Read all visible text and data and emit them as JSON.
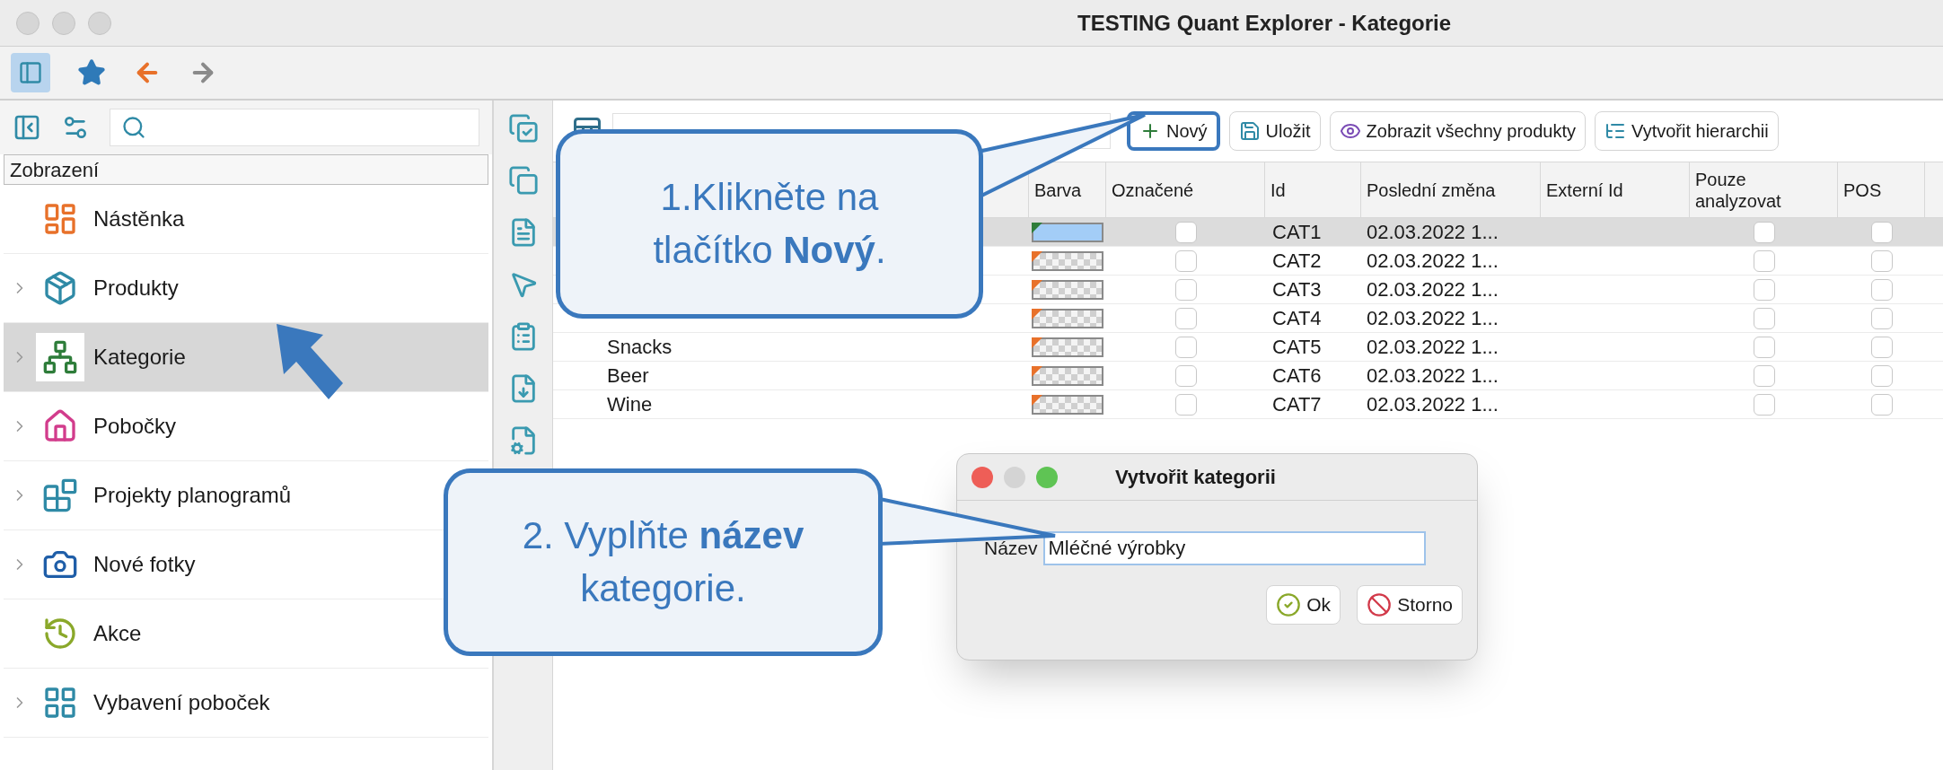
{
  "window": {
    "title": "TESTING Quant Explorer - Kategorie"
  },
  "toolbar": {
    "sidebar_toggle_on": true
  },
  "sidebar": {
    "header": "Zobrazení",
    "items": [
      {
        "label": "Nástěnka",
        "has_children": false,
        "selected": false
      },
      {
        "label": "Produkty",
        "has_children": true,
        "selected": false
      },
      {
        "label": "Kategorie",
        "has_children": true,
        "selected": true
      },
      {
        "label": "Pobočky",
        "has_children": true,
        "selected": false
      },
      {
        "label": "Projekty planogramů",
        "has_children": true,
        "selected": false
      },
      {
        "label": "Nové fotky",
        "has_children": true,
        "selected": false
      },
      {
        "label": "Akce",
        "has_children": false,
        "selected": false
      },
      {
        "label": "Vybavení poboček",
        "has_children": true,
        "selected": false
      }
    ]
  },
  "actions": [
    {
      "label": "Nový",
      "highlighted": true
    },
    {
      "label": "Uložit",
      "highlighted": false
    },
    {
      "label": "Zobrazit všechny produkty",
      "highlighted": false
    },
    {
      "label": "Vytvořit hierarchii",
      "highlighted": false
    }
  ],
  "table": {
    "columns": [
      "Barva",
      "Označené",
      "Id",
      "Poslední změna",
      "Externí Id",
      "Pouze analyzovat",
      "POS"
    ],
    "rows": [
      {
        "id": "CAT1",
        "changed": "02.03.2022 1...",
        "color": "#a3cdf7",
        "marked": false,
        "analyze_only": false,
        "pos": false,
        "selected": true
      },
      {
        "id": "CAT2",
        "changed": "02.03.2022 1...",
        "marked": false,
        "analyze_only": false,
        "pos": false,
        "selected": false
      },
      {
        "id": "CAT3",
        "changed": "02.03.2022 1...",
        "marked": false,
        "analyze_only": false,
        "pos": false,
        "selected": false
      },
      {
        "id": "CAT4",
        "changed": "02.03.2022 1...",
        "marked": false,
        "analyze_only": false,
        "pos": false,
        "selected": false
      },
      {
        "name": "Snacks",
        "id": "CAT5",
        "changed": "02.03.2022 1...",
        "marked": false,
        "analyze_only": false,
        "pos": false,
        "selected": false
      },
      {
        "name": "Beer",
        "id": "CAT6",
        "changed": "02.03.2022 1...",
        "marked": false,
        "analyze_only": false,
        "pos": false,
        "selected": false
      },
      {
        "name": "Wine",
        "id": "CAT7",
        "changed": "02.03.2022 1...",
        "marked": false,
        "analyze_only": false,
        "pos": false,
        "selected": false
      }
    ]
  },
  "dialog": {
    "title": "Vytvořit kategorii",
    "label": "Název",
    "value": "Mléčné výrobky",
    "buttons": [
      "Ok",
      "Storno"
    ]
  },
  "callouts": [
    {
      "lines": [
        "1.Klikněte na",
        "tlačítko **Nový**."
      ]
    },
    {
      "lines": [
        "2. Vyplňte **název**",
        "kategorie."
      ]
    }
  ]
}
